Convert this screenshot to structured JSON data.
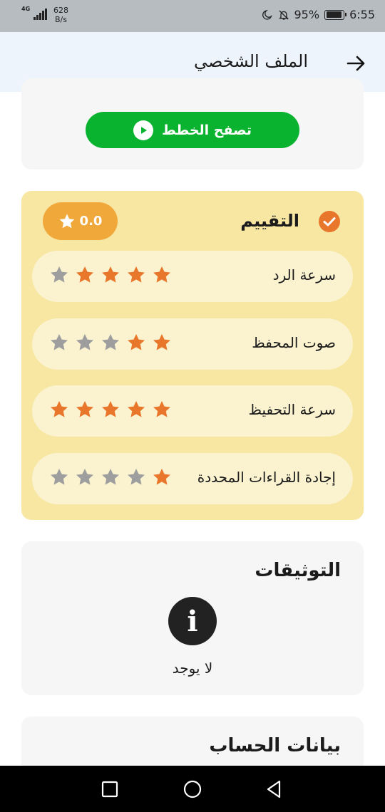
{
  "status_bar": {
    "network": "4G",
    "speed_value": "628",
    "speed_unit": "B/s",
    "battery_percent": "95%",
    "battery_level": 0.95,
    "time": "6:55"
  },
  "app_bar": {
    "title": "الملف الشخصي"
  },
  "plans": {
    "browse_label": "تصفح الخطط"
  },
  "rating": {
    "title": "التقييم",
    "score": "0.0",
    "filled_color": "#e8762b",
    "empty_color": "#9e9e9e",
    "items": [
      {
        "label": "سرعة الرد",
        "stars": 4
      },
      {
        "label": "صوت المحفظ",
        "stars": 2
      },
      {
        "label": "سرعة التحفيظ",
        "stars": 5
      },
      {
        "label": "إجادة القراءات المحددة",
        "stars": 1
      }
    ]
  },
  "documents": {
    "title": "التوثيقات",
    "empty_text": "لا يوجد"
  },
  "account": {
    "title": "بيانات الحساب"
  }
}
